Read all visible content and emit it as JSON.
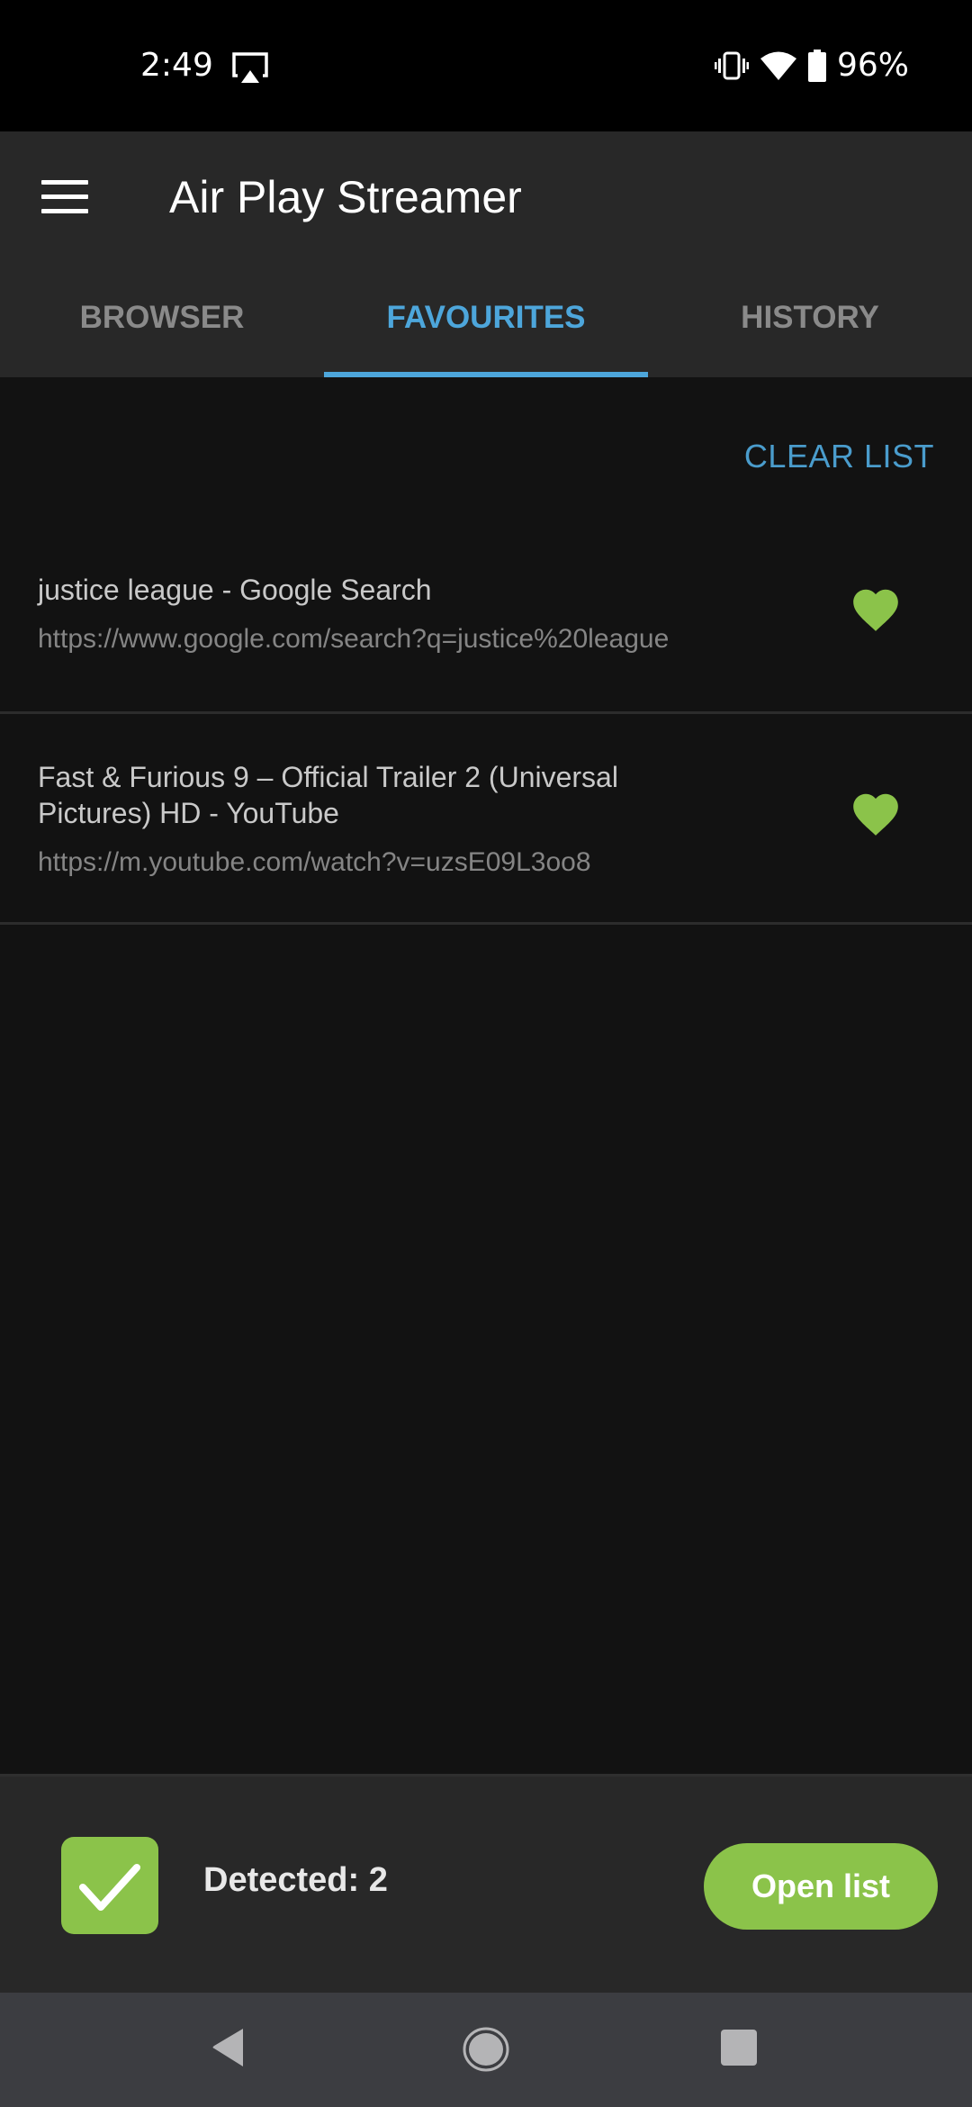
{
  "status_bar": {
    "time": "2:49",
    "battery": "96%",
    "icons": [
      "cast-icon",
      "vibrate-icon",
      "wifi-icon",
      "battery-icon"
    ]
  },
  "app_bar": {
    "title": "Air Play Streamer",
    "menu_icon": "hamburger-menu-icon"
  },
  "tabs": [
    {
      "label": "BROWSER",
      "active": false
    },
    {
      "label": "FAVOURITES",
      "active": true
    },
    {
      "label": "HISTORY",
      "active": false
    }
  ],
  "actions": {
    "clear_list": "CLEAR LIST"
  },
  "favourites": [
    {
      "title": "justice league - Google Search",
      "url": "https://www.google.com/search?q=justice%20league",
      "icon": "heart-icon"
    },
    {
      "title": "Fast & Furious 9 – Official Trailer 2 (Universal Pictures) HD - YouTube",
      "url": "https://m.youtube.com/watch?v=uzsE09L3oo8",
      "icon": "heart-icon"
    }
  ],
  "bottom_bar": {
    "detected_label": "Detected: 2",
    "open_list_label": "Open list",
    "check_icon": "checkmark-icon"
  },
  "nav_bar": {
    "buttons": [
      "back-icon",
      "home-icon",
      "recents-icon"
    ]
  },
  "colors": {
    "accent_blue": "#4da6db",
    "accent_green": "#8bc34a",
    "background": "#121212",
    "app_bar": "#282828"
  }
}
